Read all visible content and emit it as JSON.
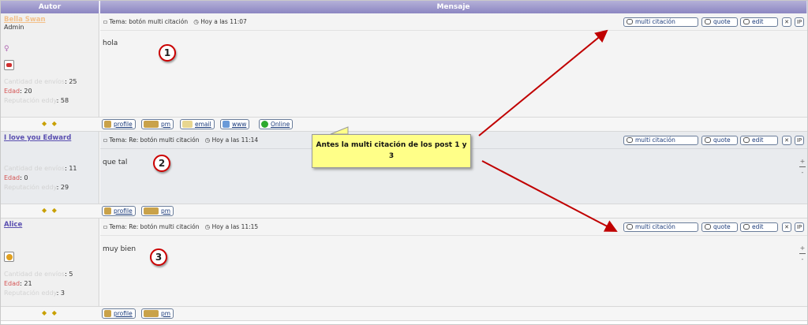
{
  "header": {
    "author": "Autor",
    "message": "Mensaje"
  },
  "posts": [
    {
      "user": "Bella Swan",
      "user_color": "#f2c08a",
      "role": "Admin",
      "topic": "Tema: botón multi citación",
      "time": "Hoy a las 11:07",
      "body": "hola",
      "number": "1",
      "stats": [
        {
          "k": "Cantidad de envíos",
          "v": "25"
        },
        {
          "k": "Edad",
          "v": "20"
        },
        {
          "k": "Reputación eddy",
          "v": "58"
        }
      ]
    },
    {
      "user": "I love you Edward",
      "user_color": "#5a4fb0",
      "role": "",
      "topic": "Tema: Re: botón multi citación",
      "time": "Hoy a las 11:14",
      "body": "que tal",
      "number": "2",
      "stats": [
        {
          "k": "Cantidad de envíos",
          "v": "11"
        },
        {
          "k": "Edad",
          "v": "0"
        },
        {
          "k": "Reputación eddy",
          "v": "29"
        }
      ]
    },
    {
      "user": "Alice",
      "user_color": "#5a4fb0",
      "role": "",
      "topic": "Tema: Re: botón multi citación",
      "time": "Hoy a las 11:15",
      "body": "muy bien",
      "number": "3",
      "stats": [
        {
          "k": "Cantidad de envíos",
          "v": "5"
        },
        {
          "k": "Edad",
          "v": "21"
        },
        {
          "k": "Reputación eddy",
          "v": "3"
        }
      ]
    }
  ],
  "buttons": {
    "multi": "multi citación",
    "quote": "quote",
    "edit": "edit",
    "delete": "✕",
    "ip": "IP"
  },
  "profile_buttons": {
    "profile": "profile",
    "pm": "pm",
    "email": "email",
    "www": "www",
    "online": "Online"
  },
  "callout": {
    "text": "Antes la multi citación de los post 1 y 3"
  },
  "footer": {
    "arrows": "◆ ◆"
  },
  "controls": {
    "plus": "+",
    "minus": "-"
  }
}
